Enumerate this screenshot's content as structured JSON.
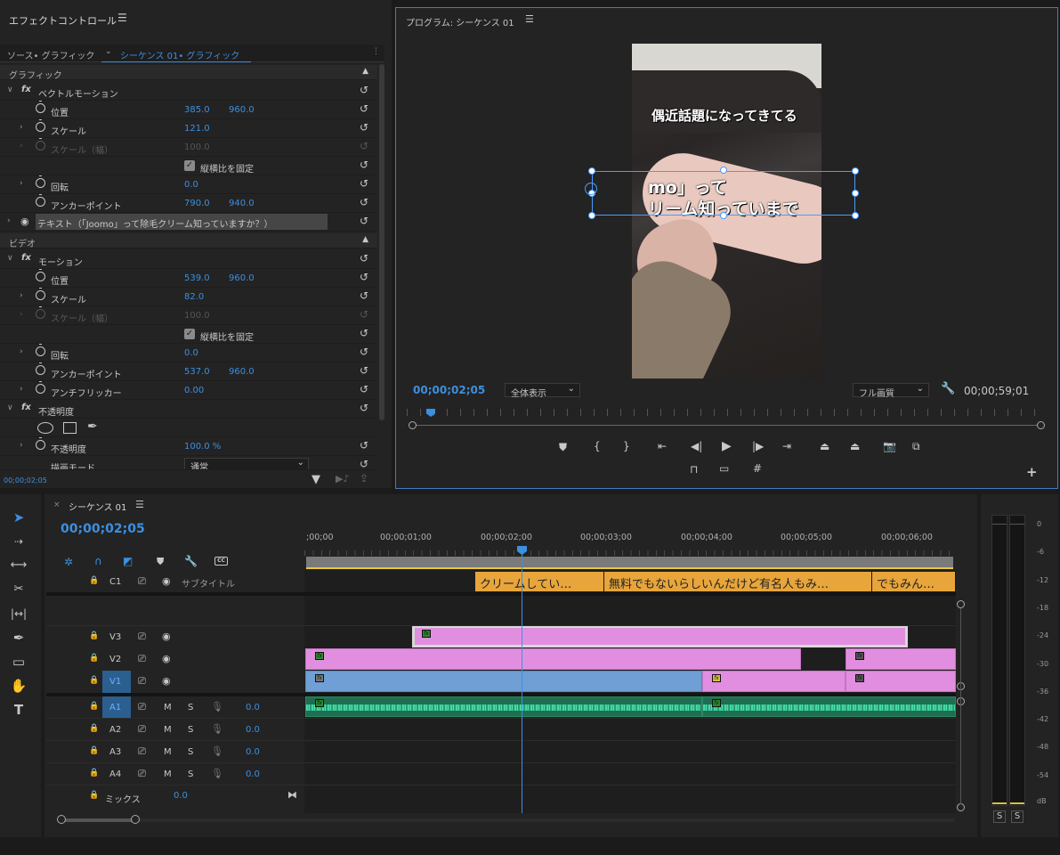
{
  "effect_controls": {
    "title": "エフェクトコントロール",
    "tab_source": "ソース• グラフィック",
    "tab_sequence": "シーケンス 01• グラフィック",
    "section_graphic": "グラフィック",
    "vector_motion": "ベクトルモーション",
    "position_label": "位置",
    "position_x": "385.0",
    "position_y": "960.0",
    "scale_label": "スケール",
    "scale_value": "121.0",
    "scale_width_label": "スケール（幅）",
    "scale_width_value": "100.0",
    "uniform_scale_label": "縦横比を固定",
    "rotation_label": "回転",
    "rotation_value": "0.0",
    "anchor_label": "アンカーポイント",
    "anchor_x": "790.0",
    "anchor_y": "940.0",
    "text_layer": "テキスト（「Joomo」って除毛クリーム知っていますか？）",
    "section_video": "ビデオ",
    "motion": "モーション",
    "m_position_x": "539.0",
    "m_position_y": "960.0",
    "m_scale_value": "82.0",
    "m_scale_width_value": "100.0",
    "m_rotation_value": "0.0",
    "m_anchor_x": "537.0",
    "m_anchor_y": "960.0",
    "antiflicker_label": "アンチフリッカー",
    "antiflicker_value": "0.00",
    "opacity_section": "不透明度",
    "opacity_label": "不透明度",
    "opacity_value": "100.0 %",
    "blend_label": "描画モード",
    "blend_value": "通常",
    "bottom_timecode": "00;00;02;05"
  },
  "program_monitor": {
    "title": "プログラム: シーケンス 01",
    "text_line1": "偶近話題になってきてる",
    "text_line2": "mo」って",
    "text_line3": "リーム知っていまで",
    "timecode": "00;00;02;05",
    "zoom_select": "全体表示",
    "quality_select": "フル画質",
    "duration": "00;00;59;01"
  },
  "timeline": {
    "tab_title": "シーケンス 01",
    "timecode": "00;00;02;05",
    "ruler": [
      ";00;00",
      "00;00;01;00",
      "00;00;02;00",
      "00;00;03;00",
      "00;00;04;00",
      "00;00;05;00",
      "00;00;06;00"
    ],
    "tracks": {
      "c1": "C1",
      "c1_name": "サブタイトル",
      "v3": "V3",
      "v2": "V2",
      "v1": "V1",
      "a1": "A1",
      "a2": "A2",
      "a3": "A3",
      "a4": "A4",
      "mix": "ミックス",
      "m": "M",
      "s": "S",
      "vol": "0.0",
      "mix_vol": "0.0"
    },
    "subtitle_clips": [
      "クリームしてい…",
      "無料でもないらしいんだけど有名人もみ…",
      "でもみん…"
    ]
  },
  "meter": {
    "labels": [
      "0",
      "-6",
      "-12",
      "-18",
      "-24",
      "-30",
      "-36",
      "-42",
      "-48",
      "-54",
      "dB"
    ],
    "solo1": "S",
    "solo2": "S"
  },
  "colors": {
    "accent": "#3d8fe0",
    "clip_pink": "#e28ee0",
    "clip_blue": "#6f9fd4",
    "audio_green": "#2fb386",
    "subtitle_orange": "#e7a53c"
  }
}
